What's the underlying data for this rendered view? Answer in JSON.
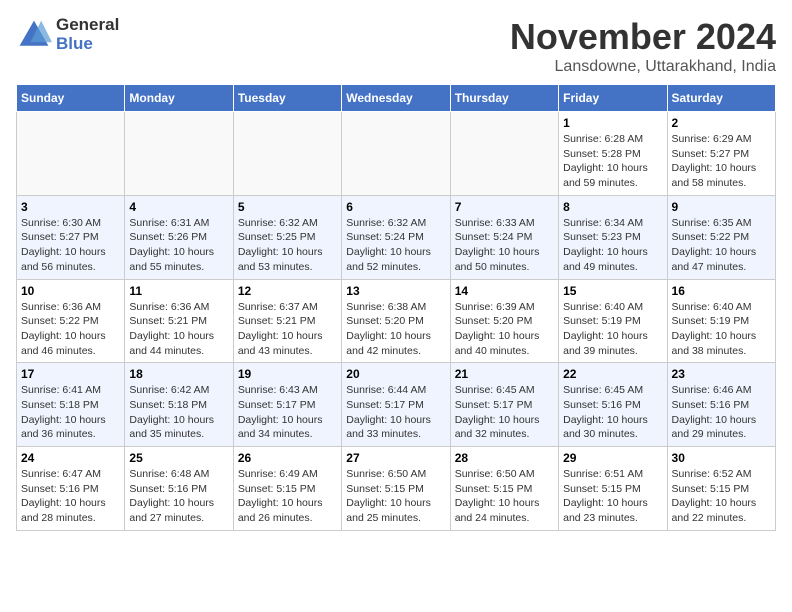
{
  "header": {
    "logo_general": "General",
    "logo_blue": "Blue",
    "month": "November 2024",
    "location": "Lansdowne, Uttarakhand, India"
  },
  "columns": [
    "Sunday",
    "Monday",
    "Tuesday",
    "Wednesday",
    "Thursday",
    "Friday",
    "Saturday"
  ],
  "weeks": [
    [
      {
        "day": "",
        "info": ""
      },
      {
        "day": "",
        "info": ""
      },
      {
        "day": "",
        "info": ""
      },
      {
        "day": "",
        "info": ""
      },
      {
        "day": "",
        "info": ""
      },
      {
        "day": "1",
        "info": "Sunrise: 6:28 AM\nSunset: 5:28 PM\nDaylight: 10 hours and 59 minutes."
      },
      {
        "day": "2",
        "info": "Sunrise: 6:29 AM\nSunset: 5:27 PM\nDaylight: 10 hours and 58 minutes."
      }
    ],
    [
      {
        "day": "3",
        "info": "Sunrise: 6:30 AM\nSunset: 5:27 PM\nDaylight: 10 hours and 56 minutes."
      },
      {
        "day": "4",
        "info": "Sunrise: 6:31 AM\nSunset: 5:26 PM\nDaylight: 10 hours and 55 minutes."
      },
      {
        "day": "5",
        "info": "Sunrise: 6:32 AM\nSunset: 5:25 PM\nDaylight: 10 hours and 53 minutes."
      },
      {
        "day": "6",
        "info": "Sunrise: 6:32 AM\nSunset: 5:24 PM\nDaylight: 10 hours and 52 minutes."
      },
      {
        "day": "7",
        "info": "Sunrise: 6:33 AM\nSunset: 5:24 PM\nDaylight: 10 hours and 50 minutes."
      },
      {
        "day": "8",
        "info": "Sunrise: 6:34 AM\nSunset: 5:23 PM\nDaylight: 10 hours and 49 minutes."
      },
      {
        "day": "9",
        "info": "Sunrise: 6:35 AM\nSunset: 5:22 PM\nDaylight: 10 hours and 47 minutes."
      }
    ],
    [
      {
        "day": "10",
        "info": "Sunrise: 6:36 AM\nSunset: 5:22 PM\nDaylight: 10 hours and 46 minutes."
      },
      {
        "day": "11",
        "info": "Sunrise: 6:36 AM\nSunset: 5:21 PM\nDaylight: 10 hours and 44 minutes."
      },
      {
        "day": "12",
        "info": "Sunrise: 6:37 AM\nSunset: 5:21 PM\nDaylight: 10 hours and 43 minutes."
      },
      {
        "day": "13",
        "info": "Sunrise: 6:38 AM\nSunset: 5:20 PM\nDaylight: 10 hours and 42 minutes."
      },
      {
        "day": "14",
        "info": "Sunrise: 6:39 AM\nSunset: 5:20 PM\nDaylight: 10 hours and 40 minutes."
      },
      {
        "day": "15",
        "info": "Sunrise: 6:40 AM\nSunset: 5:19 PM\nDaylight: 10 hours and 39 minutes."
      },
      {
        "day": "16",
        "info": "Sunrise: 6:40 AM\nSunset: 5:19 PM\nDaylight: 10 hours and 38 minutes."
      }
    ],
    [
      {
        "day": "17",
        "info": "Sunrise: 6:41 AM\nSunset: 5:18 PM\nDaylight: 10 hours and 36 minutes."
      },
      {
        "day": "18",
        "info": "Sunrise: 6:42 AM\nSunset: 5:18 PM\nDaylight: 10 hours and 35 minutes."
      },
      {
        "day": "19",
        "info": "Sunrise: 6:43 AM\nSunset: 5:17 PM\nDaylight: 10 hours and 34 minutes."
      },
      {
        "day": "20",
        "info": "Sunrise: 6:44 AM\nSunset: 5:17 PM\nDaylight: 10 hours and 33 minutes."
      },
      {
        "day": "21",
        "info": "Sunrise: 6:45 AM\nSunset: 5:17 PM\nDaylight: 10 hours and 32 minutes."
      },
      {
        "day": "22",
        "info": "Sunrise: 6:45 AM\nSunset: 5:16 PM\nDaylight: 10 hours and 30 minutes."
      },
      {
        "day": "23",
        "info": "Sunrise: 6:46 AM\nSunset: 5:16 PM\nDaylight: 10 hours and 29 minutes."
      }
    ],
    [
      {
        "day": "24",
        "info": "Sunrise: 6:47 AM\nSunset: 5:16 PM\nDaylight: 10 hours and 28 minutes."
      },
      {
        "day": "25",
        "info": "Sunrise: 6:48 AM\nSunset: 5:16 PM\nDaylight: 10 hours and 27 minutes."
      },
      {
        "day": "26",
        "info": "Sunrise: 6:49 AM\nSunset: 5:15 PM\nDaylight: 10 hours and 26 minutes."
      },
      {
        "day": "27",
        "info": "Sunrise: 6:50 AM\nSunset: 5:15 PM\nDaylight: 10 hours and 25 minutes."
      },
      {
        "day": "28",
        "info": "Sunrise: 6:50 AM\nSunset: 5:15 PM\nDaylight: 10 hours and 24 minutes."
      },
      {
        "day": "29",
        "info": "Sunrise: 6:51 AM\nSunset: 5:15 PM\nDaylight: 10 hours and 23 minutes."
      },
      {
        "day": "30",
        "info": "Sunrise: 6:52 AM\nSunset: 5:15 PM\nDaylight: 10 hours and 22 minutes."
      }
    ]
  ]
}
